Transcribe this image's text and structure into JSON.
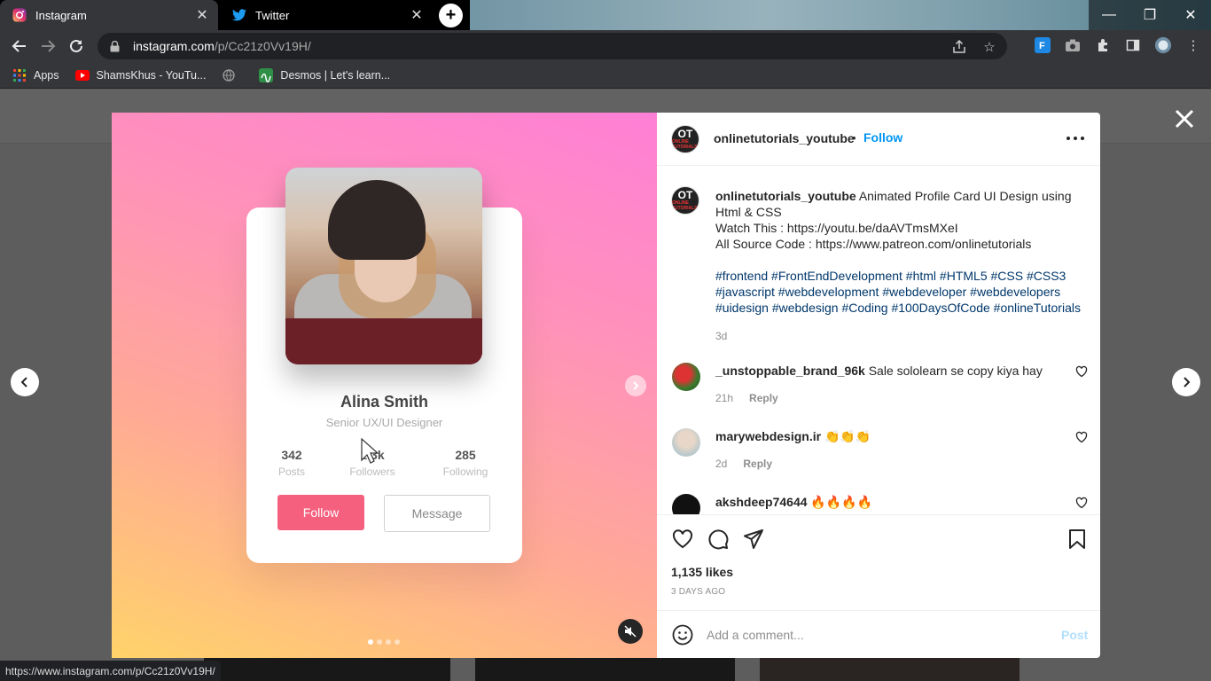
{
  "browser": {
    "tabs": [
      {
        "title": "Instagram",
        "active": true
      },
      {
        "title": "Twitter",
        "active": false
      }
    ],
    "url": {
      "host": "instagram.com",
      "path": "/p/Cc21z0Vv19H/"
    },
    "bookmarks": [
      {
        "label": "Apps",
        "icon": "apps-grid-icon"
      },
      {
        "label": "ShamsKhus - YouTu...",
        "icon": "youtube-icon"
      },
      {
        "label": "",
        "icon": "globe-icon"
      },
      {
        "label": "Desmos | Let's learn...",
        "icon": "desmos-icon"
      }
    ],
    "status_url": "https://www.instagram.com/p/Cc21z0Vv19H/"
  },
  "post": {
    "author": "onlinetutorials_youtube",
    "avatar_text": "OT",
    "avatar_subtext": "ONLINE TUTORIALS",
    "follow_label": "Follow",
    "separator": "•",
    "caption_text": "Animated Profile Card UI Design using Html & CSS",
    "caption_watch": "Watch This : https://youtu.be/daAVTmsMXeI",
    "caption_source": "All Source Code : https://www.patreon.com/onlinetutorials",
    "hashtags_1": "#frontend #FrontEndDevelopment #html #HTML5 #CSS #CSS3",
    "hashtags_2": "#javascript #webdevelopment #webdeveloper #webdevelopers",
    "hashtags_3": "#uidesign #webdesign #Coding #100DaysOfCode #onlineTutorials",
    "caption_age": "3d",
    "likes": "1,135 likes",
    "posted_ago": "3 DAYS AGO",
    "comment_placeholder": "Add a comment...",
    "post_label": "Post"
  },
  "comments": [
    {
      "user": "_unstoppable_brand_96k",
      "text": "Sale sololearn se copy kiya hay",
      "age": "21h",
      "reply": "Reply"
    },
    {
      "user": "marywebdesign.ir",
      "text": "👏👏👏",
      "age": "2d",
      "reply": "Reply"
    },
    {
      "user": "akshdeep74644",
      "text": "🔥🔥🔥🔥",
      "age": "",
      "reply": ""
    }
  ],
  "media_card": {
    "name": "Alina Smith",
    "role": "Senior UX/UI Designer",
    "stats": [
      {
        "value": "342",
        "label": "Posts"
      },
      {
        "value": "1.3k",
        "label": "Followers"
      },
      {
        "value": "285",
        "label": "Following"
      }
    ],
    "follow_label": "Follow",
    "message_label": "Message",
    "carousel_position": {
      "current": 1,
      "total": 4
    }
  },
  "colors": {
    "accent_blue": "#0095f6",
    "card_follow": "#f5607f",
    "media_gradient_top": "#ff7fd6",
    "media_gradient_bottom": "#ffd36a"
  }
}
